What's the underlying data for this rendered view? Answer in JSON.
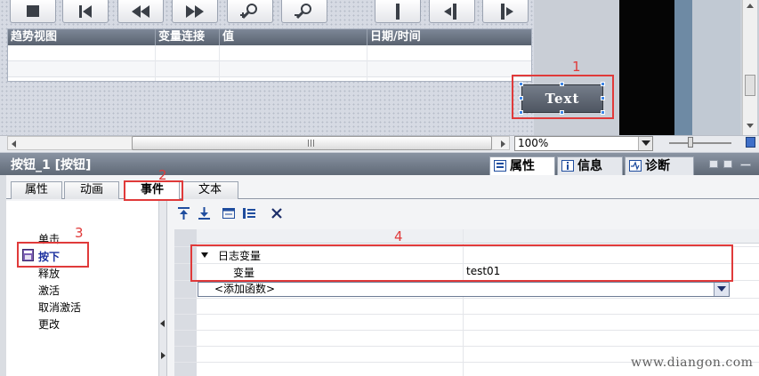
{
  "trend_view": {
    "columns": [
      "趋势视图",
      "变量连接",
      "值",
      "日期/时间"
    ]
  },
  "canvas_button": {
    "label": "Text"
  },
  "annotations": [
    "1",
    "2",
    "3",
    "4"
  ],
  "zoom": {
    "value": "100%"
  },
  "inspector": {
    "title": "按钮_1 [按钮]",
    "tabs": [
      {
        "label": "属性",
        "icon": "properties-icon",
        "active": true
      },
      {
        "label": "信息",
        "icon": "info-icon",
        "active": false
      },
      {
        "label": "诊断",
        "icon": "diagnostics-icon",
        "active": false
      }
    ]
  },
  "property_tabs": [
    {
      "label": "属性",
      "active": false
    },
    {
      "label": "动画",
      "active": false
    },
    {
      "label": "事件",
      "active": true
    },
    {
      "label": "文本",
      "active": false
    }
  ],
  "events": [
    {
      "label": "单击",
      "selected": false
    },
    {
      "label": "按下",
      "selected": true
    },
    {
      "label": "释放",
      "selected": false
    },
    {
      "label": "激活",
      "selected": false
    },
    {
      "label": "取消激活",
      "selected": false
    },
    {
      "label": "更改",
      "selected": false
    }
  ],
  "function_list": {
    "function_name": "日志变量",
    "param_name": "变量",
    "param_value": "test01",
    "add_placeholder": "<添加函数>"
  },
  "watermark": "www.diangon.com",
  "colors": {
    "annotation_red": "#e03a3a",
    "header": "#6f7985",
    "selection_blue": "#3e86e6"
  }
}
